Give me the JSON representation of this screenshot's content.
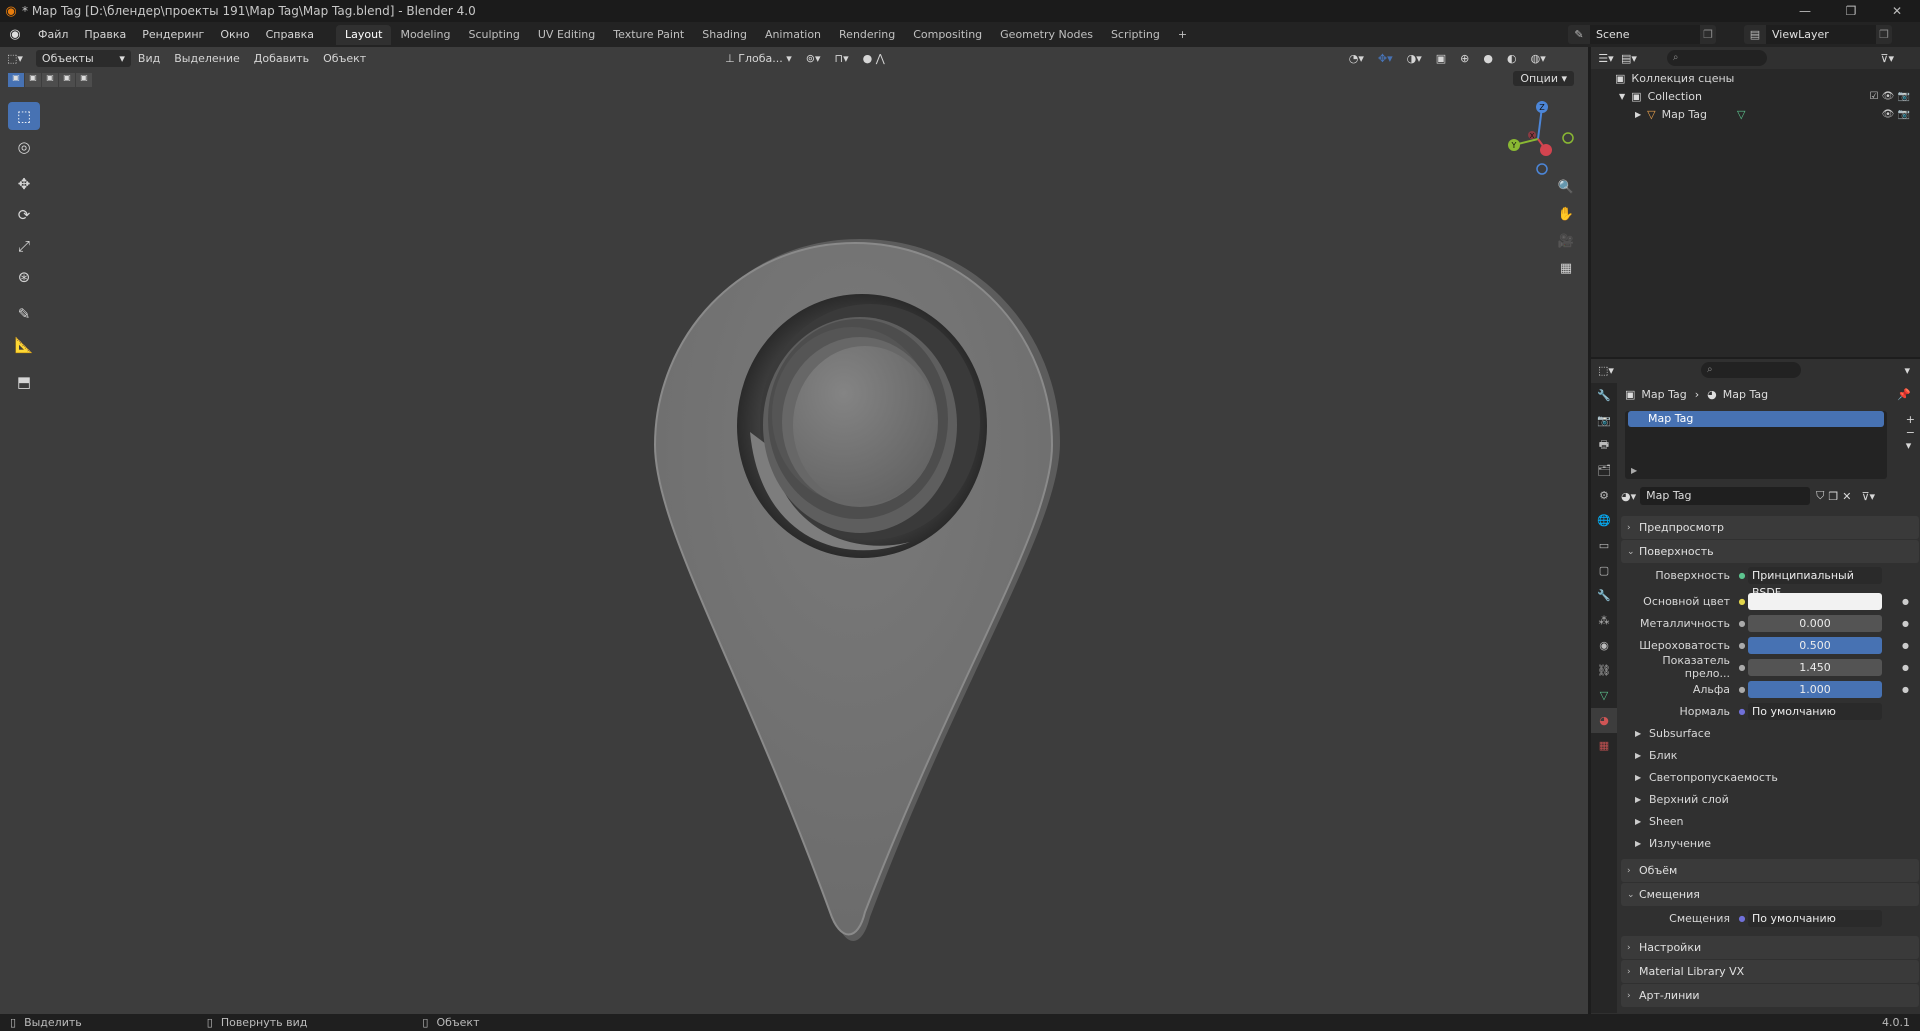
{
  "title": "* Map Tag [D:\\блендер\\проекты 191\\Map Tag\\Map Tag.blend] - Blender 4.0",
  "menu": [
    "Файл",
    "Правка",
    "Рендеринг",
    "Окно",
    "Справка"
  ],
  "workspaces": [
    "Layout",
    "Modeling",
    "Sculpting",
    "UV Editing",
    "Texture Paint",
    "Shading",
    "Animation",
    "Rendering",
    "Compositing",
    "Geometry Nodes",
    "Scripting"
  ],
  "active_workspace": "Layout",
  "scene": "Scene",
  "view_layer": "ViewLayer",
  "viewport": {
    "mode": "Объекты",
    "menu": [
      "Вид",
      "Выделение",
      "Добавить",
      "Объект"
    ],
    "orientation": "Глоба...",
    "options": "Опции"
  },
  "gizmo": {
    "x": "X",
    "y": "Y",
    "z": "Z"
  },
  "outliner": {
    "scene_collection": "Коллекция сцены",
    "collection": "Collection",
    "object": "Map Tag"
  },
  "properties": {
    "breadcrumb_obj": "Map Tag",
    "breadcrumb_mat": "Map Tag",
    "slot": "Map Tag",
    "material_name": "Map Tag",
    "preview": "Предпросмотр",
    "surface_panel": "Поверхность",
    "surface_label": "Поверхность",
    "surface_value": "Принципиальный BSDF",
    "base_color_label": "Основной цвет",
    "metallic_label": "Металличность",
    "metallic_value": "0.000",
    "roughness_label": "Шероховатость",
    "roughness_value": "0.500",
    "ior_label": "Показатель прело...",
    "ior_value": "1.450",
    "alpha_label": "Альфа",
    "alpha_value": "1.000",
    "normal_label": "Нормаль",
    "normal_value": "По умолчанию",
    "subpanels": [
      "Subsurface",
      "Блик",
      "Светопропускаемость",
      "Верхний слой",
      "Sheen",
      "Излучение"
    ],
    "volume": "Объём",
    "displacement_panel": "Смещения",
    "displacement_label": "Смещения",
    "displacement_value": "По умолчанию",
    "settings": "Настройки",
    "material_library": "Material Library VX",
    "line_art": "Арт-линии"
  },
  "status": {
    "select": "Выделить",
    "rotate": "Повернуть вид",
    "object": "Объект",
    "version": "4.0.1"
  },
  "colors": {
    "accent": "#4772b3",
    "background": "#3d3d3d",
    "brand": "#e87d0d"
  }
}
